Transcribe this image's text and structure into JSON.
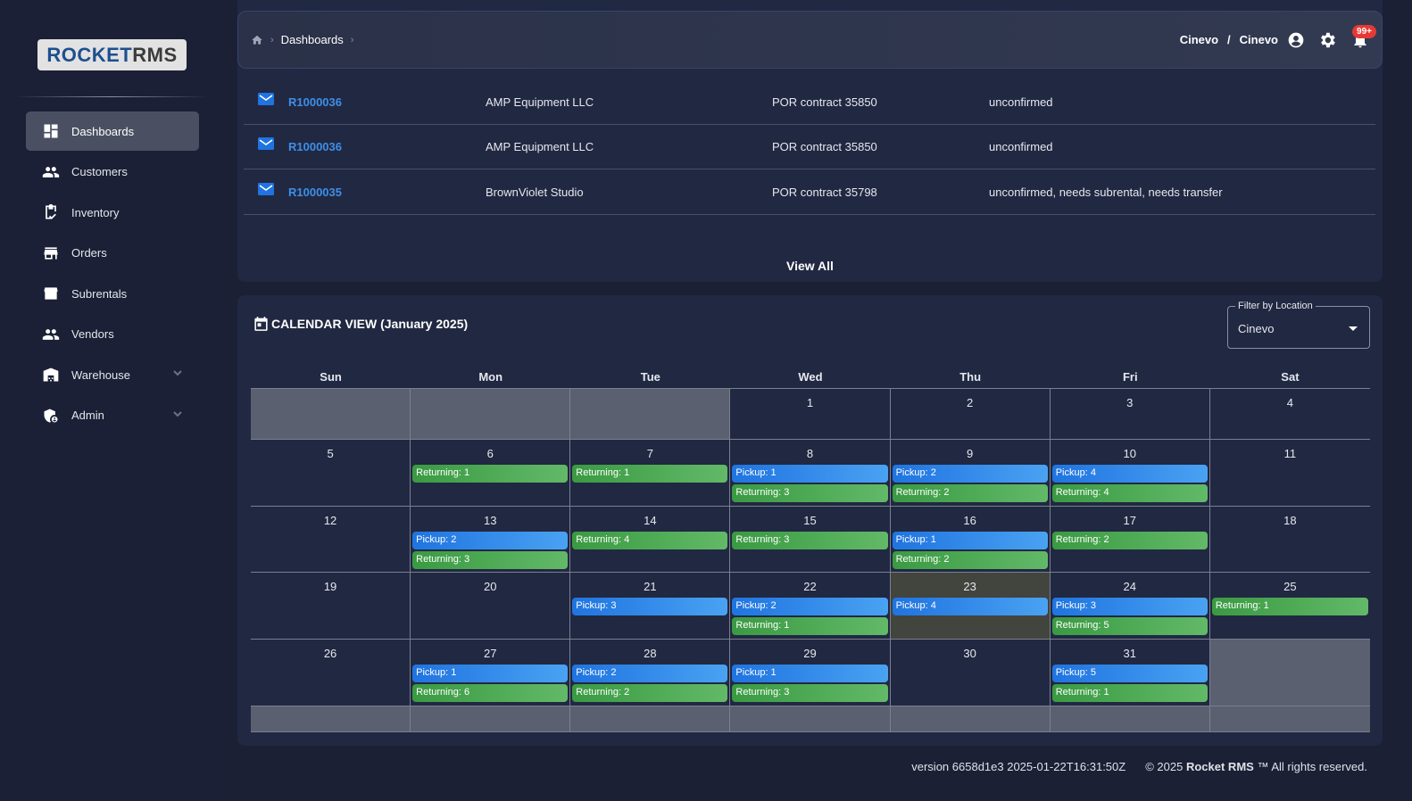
{
  "logo": {
    "text_a": "ROCKET",
    "text_b": "RMS"
  },
  "sidebar": {
    "items": [
      {
        "label": "Dashboards",
        "icon": "dashboard-icon",
        "active": true
      },
      {
        "label": "Customers",
        "icon": "people-icon"
      },
      {
        "label": "Inventory",
        "icon": "clipboard-check-icon"
      },
      {
        "label": "Orders",
        "icon": "store-icon"
      },
      {
        "label": "Subrentals",
        "icon": "storefront-icon"
      },
      {
        "label": "Vendors",
        "icon": "people-icon"
      },
      {
        "label": "Warehouse",
        "icon": "warehouse-icon",
        "expandable": true
      },
      {
        "label": "Admin",
        "icon": "admin-shield-icon",
        "expandable": true
      }
    ]
  },
  "header": {
    "breadcrumb": "Dashboards",
    "company": "Cinevo",
    "separator": "/",
    "location": "Cinevo",
    "notifications": "99+"
  },
  "orders": {
    "rows": [
      {
        "id": "R1000036",
        "customer": "AMP Equipment LLC",
        "contract": "POR contract 35850",
        "status": "unconfirmed"
      },
      {
        "id": "R1000036",
        "customer": "AMP Equipment LLC",
        "contract": "POR contract 35850",
        "status": "unconfirmed"
      },
      {
        "id": "R1000035",
        "customer": "BrownViolet Studio",
        "contract": "POR contract 35798",
        "status": "unconfirmed, needs subrental, needs transfer"
      }
    ],
    "view_all": "View All"
  },
  "calendar": {
    "title": "CALENDAR VIEW (January 2025)",
    "filter_label": "Filter by Location",
    "filter_value": "Cinevo",
    "days": [
      "Sun",
      "Mon",
      "Tue",
      "Wed",
      "Thu",
      "Fri",
      "Sat"
    ],
    "today": 23,
    "weeks": [
      [
        null,
        null,
        null,
        {
          "d": "1"
        },
        {
          "d": "2"
        },
        {
          "d": "3"
        },
        {
          "d": "4"
        }
      ],
      [
        {
          "d": "5"
        },
        {
          "d": "6",
          "ev": [
            [
              "returning",
              "Returning: 1"
            ]
          ]
        },
        {
          "d": "7",
          "ev": [
            [
              "returning",
              "Returning: 1"
            ]
          ]
        },
        {
          "d": "8",
          "ev": [
            [
              "pickup",
              "Pickup: 1"
            ],
            [
              "returning",
              "Returning: 3"
            ]
          ]
        },
        {
          "d": "9",
          "ev": [
            [
              "pickup",
              "Pickup: 2"
            ],
            [
              "returning",
              "Returning: 2"
            ]
          ]
        },
        {
          "d": "10",
          "ev": [
            [
              "pickup",
              "Pickup: 4"
            ],
            [
              "returning",
              "Returning: 4"
            ]
          ]
        },
        {
          "d": "11"
        }
      ],
      [
        {
          "d": "12"
        },
        {
          "d": "13",
          "ev": [
            [
              "pickup",
              "Pickup: 2"
            ],
            [
              "returning",
              "Returning: 3"
            ]
          ]
        },
        {
          "d": "14",
          "ev": [
            [
              "returning",
              "Returning: 4"
            ]
          ]
        },
        {
          "d": "15",
          "ev": [
            [
              "returning",
              "Returning: 3"
            ]
          ]
        },
        {
          "d": "16",
          "ev": [
            [
              "pickup",
              "Pickup: 1"
            ],
            [
              "returning",
              "Returning: 2"
            ]
          ]
        },
        {
          "d": "17",
          "ev": [
            [
              "returning",
              "Returning: 2"
            ]
          ]
        },
        {
          "d": "18"
        }
      ],
      [
        {
          "d": "19"
        },
        {
          "d": "20"
        },
        {
          "d": "21",
          "ev": [
            [
              "pickup",
              "Pickup: 3"
            ]
          ]
        },
        {
          "d": "22",
          "ev": [
            [
              "pickup",
              "Pickup: 2"
            ],
            [
              "returning",
              "Returning: 1"
            ]
          ]
        },
        {
          "d": "23",
          "ev": [
            [
              "pickup",
              "Pickup: 4"
            ]
          ]
        },
        {
          "d": "24",
          "ev": [
            [
              "pickup",
              "Pickup: 3"
            ],
            [
              "returning",
              "Returning: 5"
            ]
          ]
        },
        {
          "d": "25",
          "ev": [
            [
              "returning",
              "Returning: 1"
            ]
          ]
        }
      ],
      [
        {
          "d": "26"
        },
        {
          "d": "27",
          "ev": [
            [
              "pickup",
              "Pickup: 1"
            ],
            [
              "returning",
              "Returning: 6"
            ]
          ]
        },
        {
          "d": "28",
          "ev": [
            [
              "pickup",
              "Pickup: 2"
            ],
            [
              "returning",
              "Returning: 2"
            ]
          ]
        },
        {
          "d": "29",
          "ev": [
            [
              "pickup",
              "Pickup: 1"
            ],
            [
              "returning",
              "Returning: 3"
            ]
          ]
        },
        {
          "d": "30"
        },
        {
          "d": "31",
          "ev": [
            [
              "pickup",
              "Pickup: 5"
            ],
            [
              "returning",
              "Returning: 1"
            ]
          ]
        },
        null
      ],
      [
        null,
        null,
        null,
        null,
        null,
        null,
        null
      ]
    ]
  },
  "colors": {
    "pickup": "#1f74e0",
    "returning": "#3a9a42",
    "link": "#3d8fe8",
    "badge": "#e53935"
  },
  "footer": {
    "version": "version 6658d1e3 2025-01-22T16:31:50Z",
    "copyright_prefix": "© 2025",
    "brand": "Rocket RMS",
    "copyright_suffix": "™ All rights reserved."
  }
}
